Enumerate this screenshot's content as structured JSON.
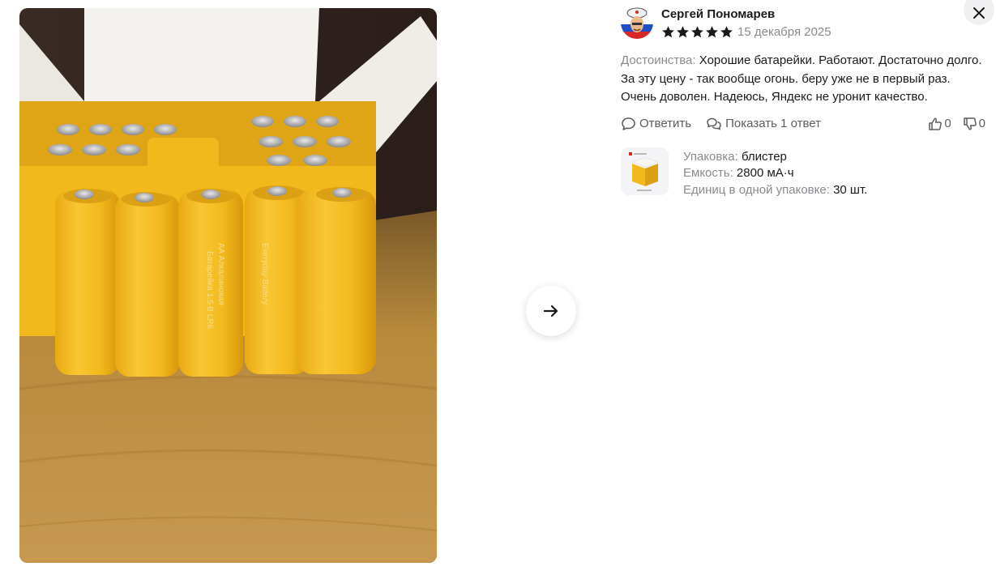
{
  "review": {
    "author": "Сергей Пономарев",
    "rating": 5,
    "date": "15 декабря 2025",
    "text_label": "Достоинства:",
    "text_body": "Хорошие батарейки. Работают. Достаточно долго. За эту цену - так вообще огонь. беру уже не в первый раз. Очень доволен. Надеюсь, Яндекс не уронит качество.",
    "reply_label": "Ответить",
    "show_replies_label": "Показать 1 ответ",
    "likes": "0",
    "dislikes": "0"
  },
  "product": {
    "props": [
      {
        "key": "Упаковка:",
        "value": "блистер"
      },
      {
        "key": "Емкость:",
        "value": "2800 мА·ч"
      },
      {
        "key": "Единиц в одной упаковке:",
        "value": "30 шт."
      }
    ]
  },
  "photo": {
    "battery_text_1": "Батарейка 1.5 В LR6",
    "battery_text_2": "AA Алкалиновая",
    "battery_text_3": "Everyday Battery"
  },
  "colors": {
    "battery_yellow": "#f2b91c",
    "wood": "#b98a3c",
    "muted_text": "#8a8a8f"
  },
  "icons": [
    "close-icon",
    "arrow-right-icon",
    "star-icon",
    "comment-icon",
    "comments-icon",
    "thumb-up-icon",
    "thumb-down-icon"
  ]
}
